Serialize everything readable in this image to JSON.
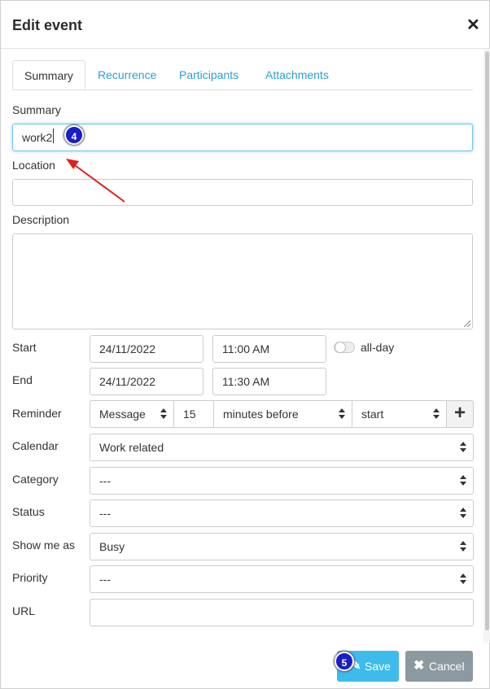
{
  "dialog": {
    "title": "Edit event",
    "close_symbol": "✕"
  },
  "tabs": [
    {
      "label": "Summary",
      "active": true
    },
    {
      "label": "Recurrence",
      "active": false
    },
    {
      "label": "Participants",
      "active": false
    },
    {
      "label": "Attachments",
      "active": false
    }
  ],
  "form": {
    "summary_label": "Summary",
    "summary_value": "work2",
    "location_label": "Location",
    "location_value": "",
    "description_label": "Description",
    "description_value": "",
    "start_label": "Start",
    "start_date": "24/11/2022",
    "start_time": "11:00 AM",
    "allday_label": "all-day",
    "allday_on": false,
    "end_label": "End",
    "end_date": "24/11/2022",
    "end_time": "11:30 AM",
    "reminder_label": "Reminder",
    "reminder_type": "Message",
    "reminder_amount": "15",
    "reminder_unit": "minutes before",
    "reminder_anchor": "start",
    "reminder_add": "+",
    "calendar_label": "Calendar",
    "calendar_value": "Work related",
    "category_label": "Category",
    "category_value": "---",
    "status_label": "Status",
    "status_value": "---",
    "showme_label": "Show me as",
    "showme_value": "Busy",
    "priority_label": "Priority",
    "priority_value": "---",
    "url_label": "URL",
    "url_value": ""
  },
  "buttons": {
    "save": "Save",
    "cancel": "Cancel"
  },
  "annotations": {
    "step4": "4",
    "step5": "5"
  },
  "colors": {
    "accent": "#3dbbeb",
    "tab_link": "#2a9fd8",
    "cancel_bg": "#8c9aa0",
    "badge": "#1a1ec8",
    "arrow": "#e02020"
  }
}
